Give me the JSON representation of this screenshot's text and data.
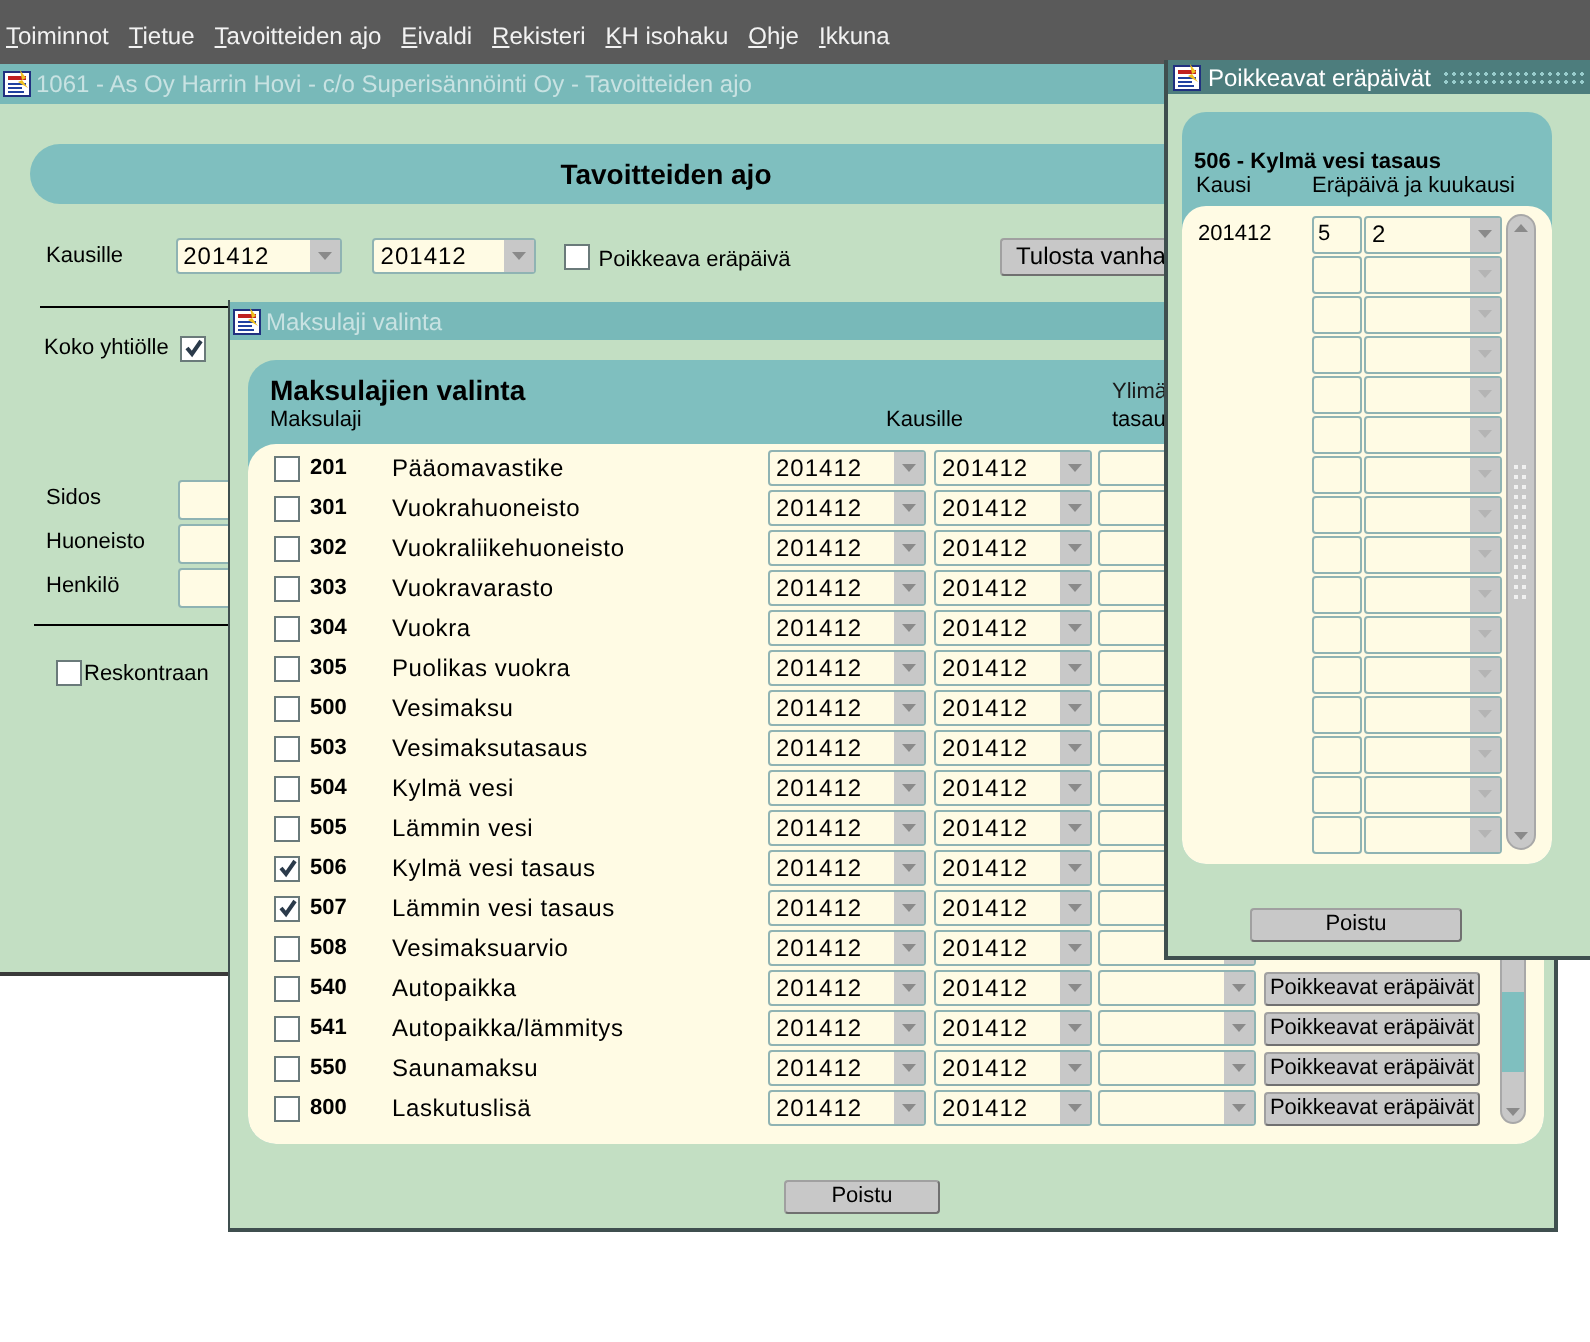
{
  "menu_bar": [
    {
      "label": "Toiminnot"
    },
    {
      "label": "Tietue"
    },
    {
      "label": "Tavoitteiden ajo"
    },
    {
      "label": "Eivaldi"
    },
    {
      "label": "Rekisteri"
    },
    {
      "label": "KH isohaku"
    },
    {
      "label": "Ohje"
    },
    {
      "label": "Ikkuna"
    }
  ],
  "main_window": {
    "title": "1061 - As Oy Harrin Hovi - c/o Superisännöinti Oy - Tavoitteiden ajo",
    "header": "Tavoitteiden ajo",
    "period_label": "Kausille",
    "period_from": "201412",
    "period_to": "201412",
    "special_due_date": {
      "label": "Poikkeava eräpäivä",
      "checked": false
    },
    "print_button": "Tulosta vanha",
    "whole_company": {
      "label": "Koko yhtiölle",
      "checked": true
    },
    "fields": [
      {
        "label": "Sidos"
      },
      {
        "label": "Huoneisto"
      },
      {
        "label": "Henkilö"
      }
    ],
    "ledger": {
      "label": "Reskontraan",
      "checked": false
    }
  },
  "charge_window": {
    "title": "Maksulaji valinta",
    "heading": "Maksulajien valinta",
    "column_1": "Maksulaji",
    "column_2": "Kausille",
    "column_3": [
      "Ylimä",
      "tasau"
    ],
    "rows": [
      {
        "checked": false,
        "code": "201",
        "name": "Pääomavastike",
        "from": "201412",
        "to": "201412"
      },
      {
        "checked": false,
        "code": "301",
        "name": "Vuokrahuoneisto",
        "from": "201412",
        "to": "201412"
      },
      {
        "checked": false,
        "code": "302",
        "name": "Vuokraliikehuoneisto",
        "from": "201412",
        "to": "201412"
      },
      {
        "checked": false,
        "code": "303",
        "name": "Vuokravarasto",
        "from": "201412",
        "to": "201412"
      },
      {
        "checked": false,
        "code": "304",
        "name": "Vuokra",
        "from": "201412",
        "to": "201412"
      },
      {
        "checked": false,
        "code": "305",
        "name": "Puolikas vuokra",
        "from": "201412",
        "to": "201412"
      },
      {
        "checked": false,
        "code": "500",
        "name": "Vesimaksu",
        "from": "201412",
        "to": "201412"
      },
      {
        "checked": false,
        "code": "503",
        "name": "Vesimaksutasaus",
        "from": "201412",
        "to": "201412"
      },
      {
        "checked": false,
        "code": "504",
        "name": "Kylmä vesi",
        "from": "201412",
        "to": "201412"
      },
      {
        "checked": false,
        "code": "505",
        "name": "Lämmin vesi",
        "from": "201412",
        "to": "201412"
      },
      {
        "checked": true,
        "code": "506",
        "name": "Kylmä vesi tasaus",
        "from": "201412",
        "to": "201412"
      },
      {
        "checked": true,
        "code": "507",
        "name": "Lämmin vesi tasaus",
        "from": "201412",
        "to": "201412"
      },
      {
        "checked": false,
        "code": "508",
        "name": "Vesimaksuarvio",
        "from": "201412",
        "to": "201412"
      },
      {
        "checked": false,
        "code": "540",
        "name": "Autopaikka",
        "from": "201412",
        "to": "201412",
        "button": "Poikkeavat eräpäivät"
      },
      {
        "checked": false,
        "code": "541",
        "name": "Autopaikka/lämmitys",
        "from": "201412",
        "to": "201412",
        "button": "Poikkeavat eräpäivät"
      },
      {
        "checked": false,
        "code": "550",
        "name": "Saunamaksu",
        "from": "201412",
        "to": "201412",
        "button": "Poikkeavat eräpäivät"
      },
      {
        "checked": false,
        "code": "800",
        "name": "Laskutuslisä",
        "from": "201412",
        "to": "201412",
        "button": "Poikkeavat eräpäivät"
      }
    ],
    "close_button": "Poistu"
  },
  "due_date_window": {
    "title": "Poikkeavat eräpäivät",
    "heading": "506 - Kylmä vesi tasaus",
    "column_1": "Kausi",
    "column_2": "Eräpäivä ja kuukausi",
    "rows": [
      {
        "period": "201412",
        "day": "5",
        "month": "2"
      }
    ],
    "close_button": "Poistu"
  }
}
